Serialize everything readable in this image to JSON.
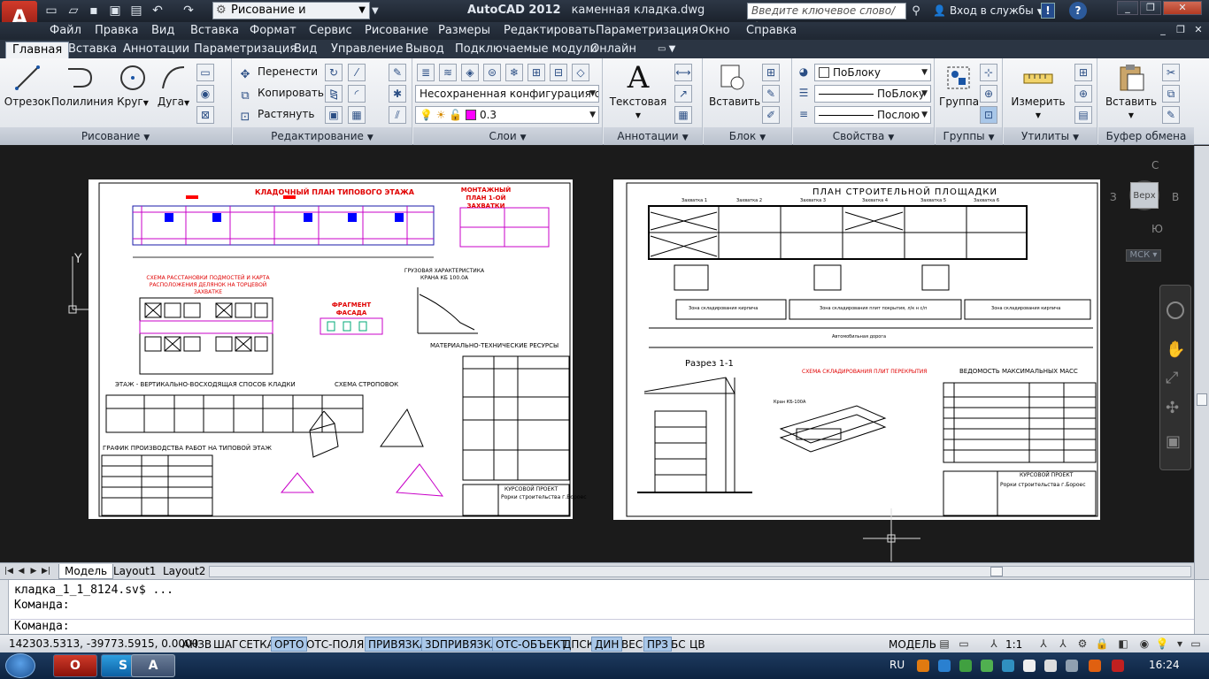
{
  "app": {
    "logo": "A",
    "name": "AutoCAD 2012",
    "file": "каменная кладка.dwg"
  },
  "toolbar": {
    "workspace": "Рисование и аннотации",
    "search_placeholder": "Введите ключевое слово/фразу",
    "login": "Вход в службы"
  },
  "menu": [
    "Файл",
    "Правка",
    "Вид",
    "Вставка",
    "Формат",
    "Сервис",
    "Рисование",
    "Размеры",
    "Редактировать",
    "Параметризация",
    "Окно",
    "Справка"
  ],
  "tabs": [
    "Главная",
    "Вставка",
    "Аннотации",
    "Параметризация",
    "Вид",
    "Управление",
    "Вывод",
    "Подключаемые модули",
    "Онлайн"
  ],
  "ribbon": {
    "draw": {
      "label": "Рисование",
      "line": "Отрезок",
      "polyline": "Полилиния",
      "circle": "Круг",
      "arc": "Дуга"
    },
    "modify": {
      "label": "Редактирование",
      "move": "Перенести",
      "copy": "Копировать",
      "stretch": "Растянуть"
    },
    "layers": {
      "label": "Слои",
      "config": "Несохраненная конфигурация сло",
      "current": "0.3"
    },
    "annot": {
      "label": "Аннотации",
      "text": "Текстовая"
    },
    "block": {
      "label": "Блок",
      "insert": "Вставить"
    },
    "props": {
      "label": "Свойства",
      "color": "ПоБлоку",
      "lineweight": "ПоБлоку",
      "linetype": "Послою"
    },
    "groups": {
      "label": "Группы",
      "group": "Группа"
    },
    "utils": {
      "label": "Утилиты",
      "measure": "Измерить"
    },
    "clipboard": {
      "label": "Буфер обмена",
      "paste": "Вставить"
    }
  },
  "viewcube": {
    "n": "С",
    "s": "Ю",
    "w": "З",
    "e": "В",
    "face": "Верх",
    "ucs": "МСК"
  },
  "layout_tabs": [
    "Модель",
    "Layout1",
    "Layout2"
  ],
  "command": {
    "lines": [
      "кладка_1_1_8124.sv$ ...",
      "Команда:"
    ],
    "prompt": "Команда:"
  },
  "status": {
    "coords": "142303.5313, -39773.5915, 0.0000",
    "toggles": [
      {
        "label": "АНЗВ",
        "on": false
      },
      {
        "label": "ШАГ",
        "on": false
      },
      {
        "label": "СЕТКА",
        "on": false
      },
      {
        "label": "ОРТО",
        "on": true
      },
      {
        "label": "ОТС-ПОЛЯР",
        "on": false
      },
      {
        "label": "ПРИВЯЗКА",
        "on": true
      },
      {
        "label": "3DПРИВЯЗКА",
        "on": true
      },
      {
        "label": "ОТС-ОБЪЕКТ",
        "on": true
      },
      {
        "label": "ДПСК",
        "on": false
      },
      {
        "label": "ДИН",
        "on": true
      },
      {
        "label": "ВЕС",
        "on": false
      },
      {
        "label": "ПРЗ",
        "on": true
      },
      {
        "label": "БС",
        "on": false
      },
      {
        "label": "ЦВ",
        "on": false
      }
    ],
    "space": "МОДЕЛЬ",
    "scale": "1:1"
  },
  "taskbar": {
    "lang": "RU",
    "time": "16:24"
  },
  "drawing": {
    "sheet1": {
      "plan_title": "КЛАДОЧНЫЙ ПЛАН ТИПОВОГО ЭТАЖА",
      "montage": "МОНТАЖНЫЙ ПЛАН 1-ОЙ ЗАХВАТКИ",
      "scheme": "СХЕМА РАССТАНОВКИ ПОДМОСТЕЙ И КАРТА РАСПОЛОЖЕНИЯ ДЕЛЯНОК НА ТОРЦЕВОЙ ЗАХВАТКЕ",
      "fragment": "ФРАГМЕНТ ФАСАДА",
      "crane": "ГРУЗОВАЯ ХАРАКТЕРИСТИКА КРАНА КБ 100.0А",
      "resources": "МАТЕРИАЛЬНО-ТЕХНИЧЕСКИЕ РЕСУРСЫ",
      "floor": "ЭТАЖ - ВЕРТИКАЛЬНО-ВОСХОДЯЩАЯ СПОСОБ КЛАДКИ",
      "slings": "СХЕМА СТРОПОВОК",
      "schedule": "ГРАФИК ПРОИЗВОДСТВА РАБОТ НА ТИПОВОЙ ЭТАЖ",
      "stamp": "КУРСОВОЙ ПРОЕКТ",
      "stamp2": "Рорки строительства г.Бороес"
    },
    "sheet2": {
      "title": "ПЛАН СТРОИТЕЛЬНОЙ ПЛОЩАДКИ",
      "grips": [
        "Захватка 1",
        "Захватка 2",
        "Захватка 3",
        "Захватка 4",
        "Захватка 5",
        "Захватка 6"
      ],
      "zone1": "Зона складирования кирпича",
      "zone2": "Зона складирования плит покрытия, л/к н с/п",
      "zone3": "Зона складирования кирпича",
      "road": "Автомобильная дорога",
      "section": "Разрез 1-1",
      "scheme": "СХЕМА СКЛАДИРОВАНИЯ ПЛИТ ПЕРЕКРЫТИЯ",
      "table_title": "ВЕДОМОСТЬ МАКСИМАЛЬНЫХ МАСС",
      "crane": "Кран КБ-100А",
      "stamp": "КУРСОВОЙ ПРОЕКТ",
      "stamp2": "Рорки строительства г.Бороес"
    }
  }
}
